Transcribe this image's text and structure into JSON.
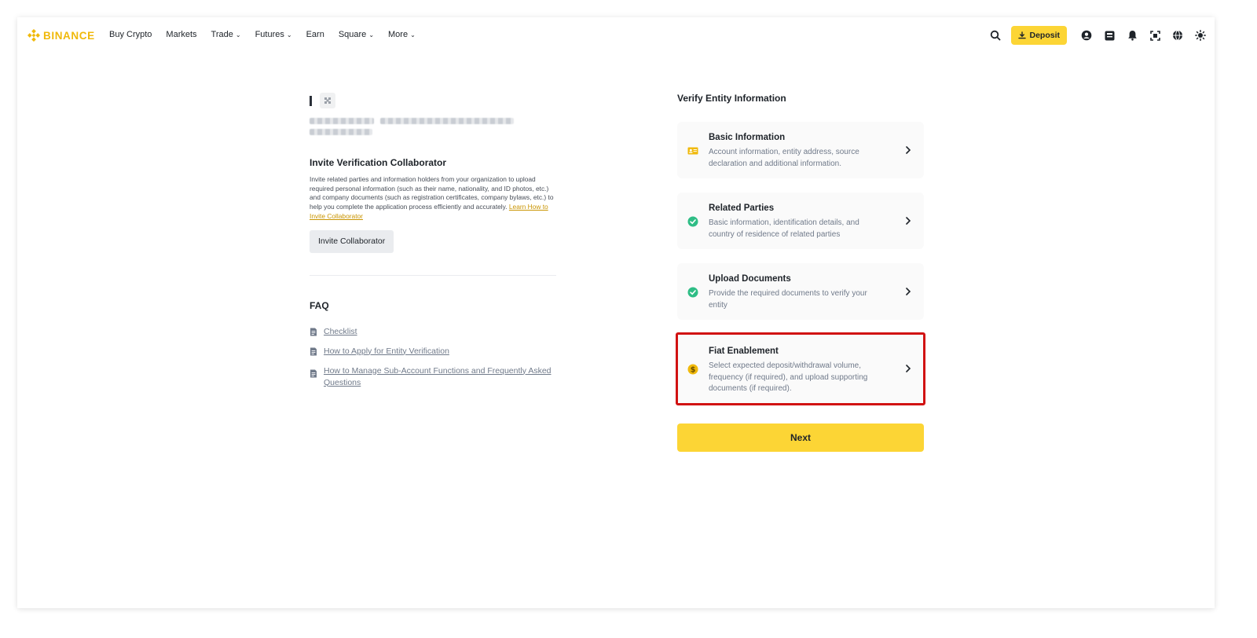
{
  "header": {
    "brand": "BINANCE",
    "nav": [
      {
        "label": "Buy Crypto",
        "dropdown": false
      },
      {
        "label": "Markets",
        "dropdown": false
      },
      {
        "label": "Trade",
        "dropdown": true
      },
      {
        "label": "Futures",
        "dropdown": true
      },
      {
        "label": "Earn",
        "dropdown": false
      },
      {
        "label": "Square",
        "dropdown": true
      },
      {
        "label": "More",
        "dropdown": true
      }
    ],
    "deposit_label": "Deposit",
    "icons": [
      "search-icon",
      "user-icon",
      "orders-icon",
      "bell-icon",
      "download-app-icon",
      "globe-icon",
      "theme-icon"
    ]
  },
  "left": {
    "invite_title": "Invite Verification Collaborator",
    "invite_desc": "Invite related parties and information holders from your organization to upload required personal information (such as their name, nationality, and ID photos, etc.) and company documents (such as registration certificates, company bylaws, etc.) to help you complete the application process efficiently and accurately.",
    "invite_link": "Learn How to Invite Collaborator",
    "invite_button": "Invite Collaborator",
    "faq_title": "FAQ",
    "faq_items": [
      "Checklist",
      "How to Apply for Entity Verification",
      "How to Manage Sub-Account Functions and Frequently Asked Questions"
    ]
  },
  "right": {
    "title": "Verify Entity Information",
    "cards": [
      {
        "title": "Basic Information",
        "desc": "Account information, entity address, source declaration and additional information.",
        "status": "pending"
      },
      {
        "title": "Related Parties",
        "desc": "Basic information, identification details, and country of residence of related parties",
        "status": "completed"
      },
      {
        "title": "Upload Documents",
        "desc": "Provide the required documents to verify your entity",
        "status": "completed"
      },
      {
        "title": "Fiat Enablement",
        "desc": "Select expected deposit/withdrawal volume, frequency (if required), and upload supporting documents (if required).",
        "status": "fiat"
      }
    ],
    "next_button": "Next"
  },
  "colors": {
    "brand": "#f0b90b",
    "button_yellow": "#fcd535",
    "success": "#2ebd85",
    "highlight": "#d11212"
  }
}
